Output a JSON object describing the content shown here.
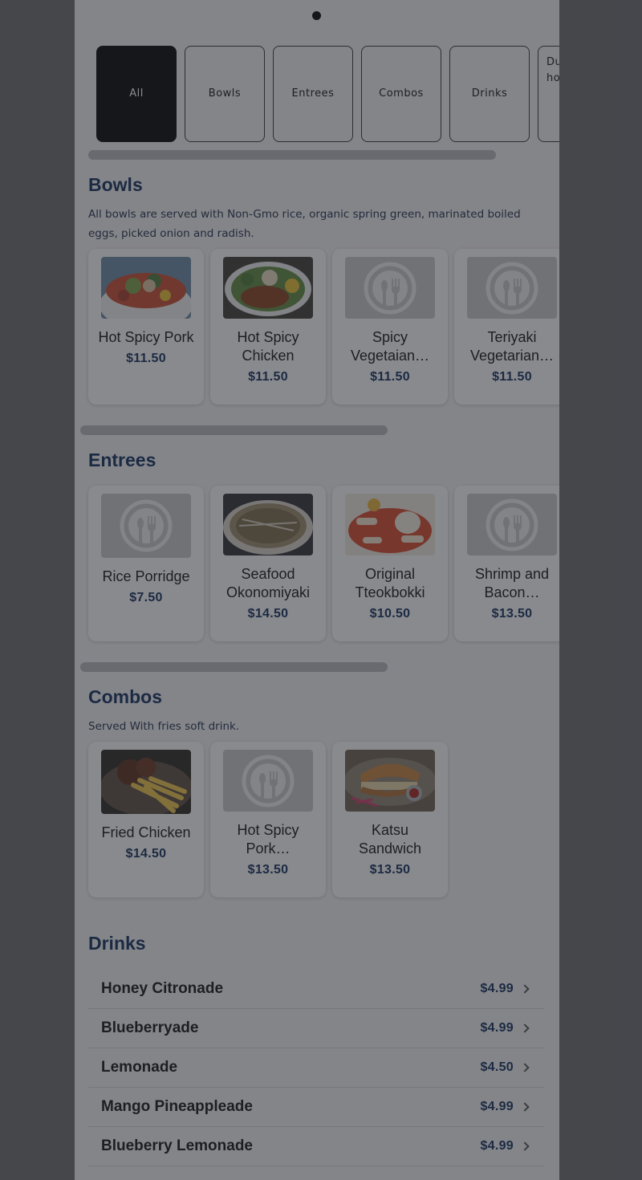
{
  "categories": [
    {
      "label": "All",
      "active": true
    },
    {
      "label": "Bowls",
      "active": false
    },
    {
      "label": "Entrees",
      "active": false
    },
    {
      "label": "Combos",
      "active": false
    },
    {
      "label": "Drinks",
      "active": false
    },
    {
      "label": "Du\nho",
      "active": false
    }
  ],
  "bowls": {
    "title": "Bowls",
    "description": "All bowls are served with Non-Gmo rice, organic spring green, marinated boiled eggs, picked onion and radish.",
    "items": [
      {
        "name": "Hot Spicy Pork",
        "price": "$11.50",
        "image": "bowl-pork-photo"
      },
      {
        "name": "Hot Spicy Chicken",
        "price": "$11.50",
        "image": "bowl-chicken-photo"
      },
      {
        "name": "Spicy Vegetaian…",
        "price": "$11.50",
        "image": "placeholder-utensils-icon"
      },
      {
        "name": "Teriyaki Vegetarian…",
        "price": "$11.50",
        "image": "placeholder-utensils-icon"
      }
    ]
  },
  "entrees": {
    "title": "Entrees",
    "items": [
      {
        "name": "Rice Porridge",
        "price": "$7.50",
        "image": "placeholder-utensils-icon"
      },
      {
        "name": "Seafood Okonomiyaki",
        "price": "$14.50",
        "image": "okonomiyaki-photo"
      },
      {
        "name": "Original Tteokbokki",
        "price": "$10.50",
        "image": "tteokbokki-photo"
      },
      {
        "name": "Shrimp and Bacon…",
        "price": "$13.50",
        "image": "placeholder-utensils-icon"
      }
    ]
  },
  "combos": {
    "title": "Combos",
    "description": "Served With fries soft drink.",
    "items": [
      {
        "name": "Fried Chicken",
        "price": "$14.50",
        "image": "fried-chicken-photo"
      },
      {
        "name": "Hot Spicy Pork…",
        "price": "$13.50",
        "image": "placeholder-utensils-icon"
      },
      {
        "name": "Katsu Sandwich",
        "price": "$13.50",
        "image": "katsu-sandwich-photo"
      }
    ]
  },
  "drinks": {
    "title": "Drinks",
    "items": [
      {
        "name": "Honey Citronade",
        "price": "$4.99"
      },
      {
        "name": "Blueberryade",
        "price": "$4.99"
      },
      {
        "name": "Lemonade",
        "price": "$4.50"
      },
      {
        "name": "Mango Pineappleade",
        "price": "$4.99"
      },
      {
        "name": "Blueberry Lemonade",
        "price": "$4.99"
      }
    ]
  },
  "colors": {
    "accent_navy": "#0d2a5c",
    "overlay": "rgba(40,42,48,0.55)",
    "active_tab": "#000000"
  }
}
